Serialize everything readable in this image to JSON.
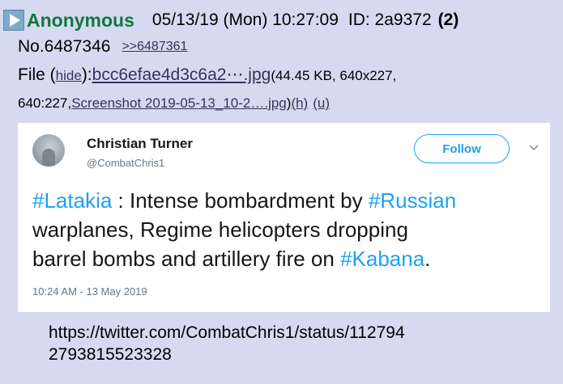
{
  "post": {
    "name": "Anonymous",
    "datetime": "05/13/19 (Mon) 10:27:09",
    "poster_id": "ID: 2a9372",
    "reply_count": "(2)",
    "post_number": "No.6487346",
    "quote_link": ">>6487361"
  },
  "file": {
    "label": "File (",
    "hide_label": "hide",
    "label_close": "): ",
    "filename": "bcc6efae4d3c6a2⋯.jpg",
    "info_open": " (44.45 KB, 640x227,",
    "dims2": "640:227, ",
    "original_name": "Screenshot 2019-05-13_10-2….jpg",
    "paren_close": ") ",
    "h_link": "(h)",
    "u_link": "(u)"
  },
  "tweet": {
    "author_name": "Christian Turner",
    "author_handle": "@CombatChris1",
    "follow_label": "Follow",
    "body": {
      "line1_tag1": "#Latakia",
      "line1_text": " : Intense bombardment by ",
      "line1_tag2": "#Russian",
      "line2_text": "warplanes, Regime helicopters dropping",
      "line3_text": "barrel bombs and artillery fire on ",
      "line3_tag": "#Kabana",
      "line3_end": "."
    },
    "timestamp": "10:24 AM - 13 May 2019"
  },
  "comment": {
    "url_line1": "https://twitter.com/CombatChris1/status/112794",
    "url_line2": "2793815523328"
  },
  "colors": {
    "background": "#d6daf0",
    "name_green": "#117743",
    "link": "#34345c",
    "twitter_blue": "#1da1f2"
  }
}
